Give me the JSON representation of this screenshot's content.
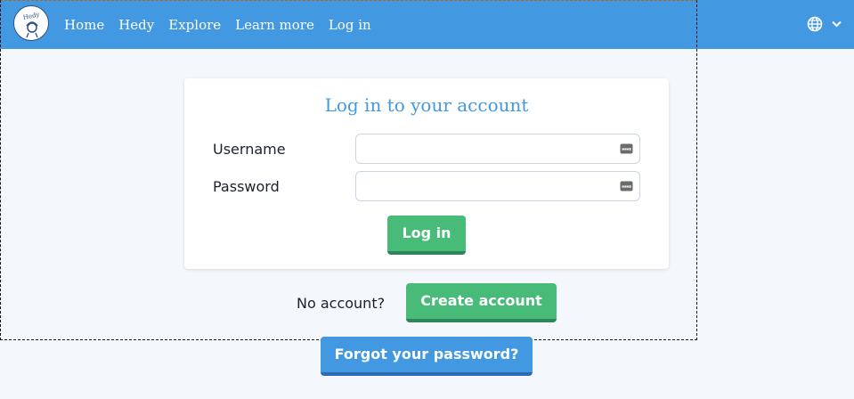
{
  "nav": {
    "logo_alt": "Hedy",
    "links": [
      "Home",
      "Hedy",
      "Explore",
      "Learn more",
      "Log in"
    ],
    "language_icon": "globe-icon",
    "language_chevron_icon": "chevron-down-icon"
  },
  "login_card": {
    "title": "Log in to your account",
    "username_label": "Username",
    "username_value": "",
    "password_label": "Password",
    "password_value": "",
    "field_icon": "password-manager-icon",
    "login_button": "Log in"
  },
  "register": {
    "prompt": "No account?",
    "create_button": "Create account"
  },
  "forgot_button": "Forgot your password?",
  "colors": {
    "nav_bg": "#4299e1",
    "title": "#4299e1",
    "green": "#48bb78",
    "blue_button": "#4299e1",
    "page_bg": "#f4f8fc"
  }
}
